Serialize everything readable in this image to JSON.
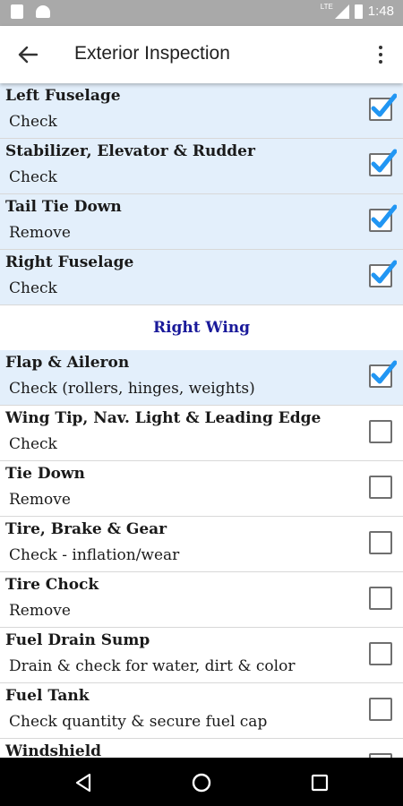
{
  "status_bar": {
    "time": "1:48",
    "network": "LTE"
  },
  "header": {
    "title": "Exterior Inspection"
  },
  "items_top": [
    {
      "name": "Left Fuselage",
      "action": "Check",
      "checked": true
    },
    {
      "name": "Stabilizer, Elevator & Rudder",
      "action": "Check",
      "checked": true
    },
    {
      "name": "Tail Tie Down",
      "action": "Remove",
      "checked": true
    },
    {
      "name": "Right Fuselage",
      "action": "Check",
      "checked": true
    }
  ],
  "section": {
    "title": "Right Wing"
  },
  "items_bottom": [
    {
      "name": "Flap & Aileron",
      "action": "Check (rollers, hinges, weights)",
      "checked": true
    },
    {
      "name": "Wing Tip, Nav. Light & Leading Edge",
      "action": "Check",
      "checked": false
    },
    {
      "name": "Tie Down",
      "action": "Remove",
      "checked": false
    },
    {
      "name": "Tire, Brake & Gear",
      "action": "Check - inflation/wear",
      "checked": false
    },
    {
      "name": "Tire Chock",
      "action": "Remove",
      "checked": false
    },
    {
      "name": "Fuel Drain Sump",
      "action": "Drain & check for water, dirt & color",
      "checked": false
    },
    {
      "name": "Fuel Tank",
      "action": "Check quantity & secure fuel cap",
      "checked": false
    },
    {
      "name": "Windshield",
      "action": "",
      "checked": false
    }
  ],
  "colors": {
    "checked_row_bg": "#e3effb",
    "check_mark": "#2196f3",
    "section_title": "#1a1a9a",
    "status_bar": "#a9a9a9"
  },
  "icons": {
    "back": "arrow-left-icon",
    "menu": "more-vertical-icon",
    "nav_back": "triangle-back-icon",
    "nav_home": "circle-home-icon",
    "nav_recent": "square-recent-icon"
  }
}
